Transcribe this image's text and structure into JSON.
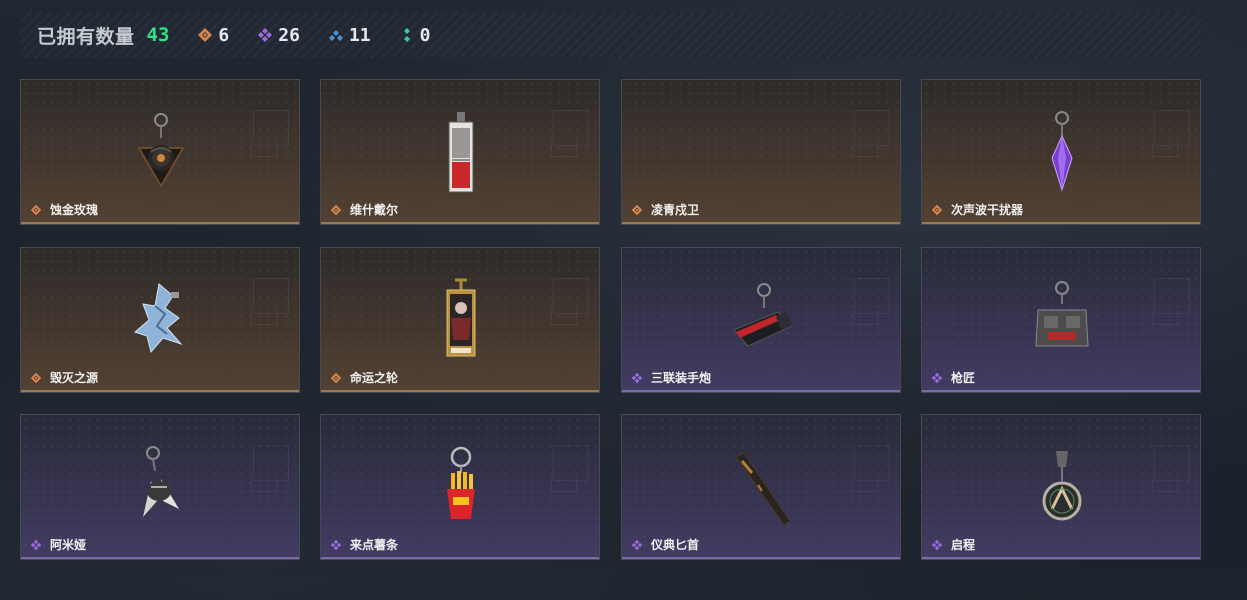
{
  "header": {
    "owned_label": "已拥有数量",
    "owned_count": "43",
    "rarities": [
      {
        "icon": "legendary-rarity-icon",
        "color": "#d5854a",
        "count": "6"
      },
      {
        "icon": "epic-rarity-icon",
        "color": "#9b6ce0",
        "count": "26"
      },
      {
        "icon": "rare-rarity-icon",
        "color": "#4d8fd6",
        "count": "11"
      },
      {
        "icon": "common-rarity-icon",
        "color": "#3fc89c",
        "count": "0"
      }
    ]
  },
  "colors": {
    "legendary": "#d5854a",
    "epic": "#9b6ce0",
    "count_green": "#35e089"
  },
  "items": [
    {
      "name": "蚀金玫瑰",
      "rarity": "legendary",
      "art": "dark-rose-charm-icon"
    },
    {
      "name": "维什戴尔",
      "rarity": "legendary",
      "art": "card-charm-icon"
    },
    {
      "name": "凌青戍卫",
      "rarity": "legendary",
      "art": "none"
    },
    {
      "name": "次声波干扰器",
      "rarity": "legendary",
      "art": "purple-crystal-charm-icon"
    },
    {
      "name": "毁灭之源",
      "rarity": "legendary",
      "art": "ice-dragon-charm-icon"
    },
    {
      "name": "命运之轮",
      "rarity": "legendary",
      "art": "tarot-card-charm-icon"
    },
    {
      "name": "三联装手炮",
      "rarity": "epic",
      "art": "red-hand-cannon-charm-icon"
    },
    {
      "name": "枪匠",
      "rarity": "epic",
      "art": "gunsmith-vest-charm-icon"
    },
    {
      "name": "阿米娅",
      "rarity": "epic",
      "art": "bunny-ears-charm-icon"
    },
    {
      "name": "来点薯条",
      "rarity": "epic",
      "art": "french-fries-charm-icon"
    },
    {
      "name": "仪典匕首",
      "rarity": "epic",
      "art": "dagger-charm-icon"
    },
    {
      "name": "启程",
      "rarity": "epic",
      "art": "medal-charm-icon"
    }
  ]
}
